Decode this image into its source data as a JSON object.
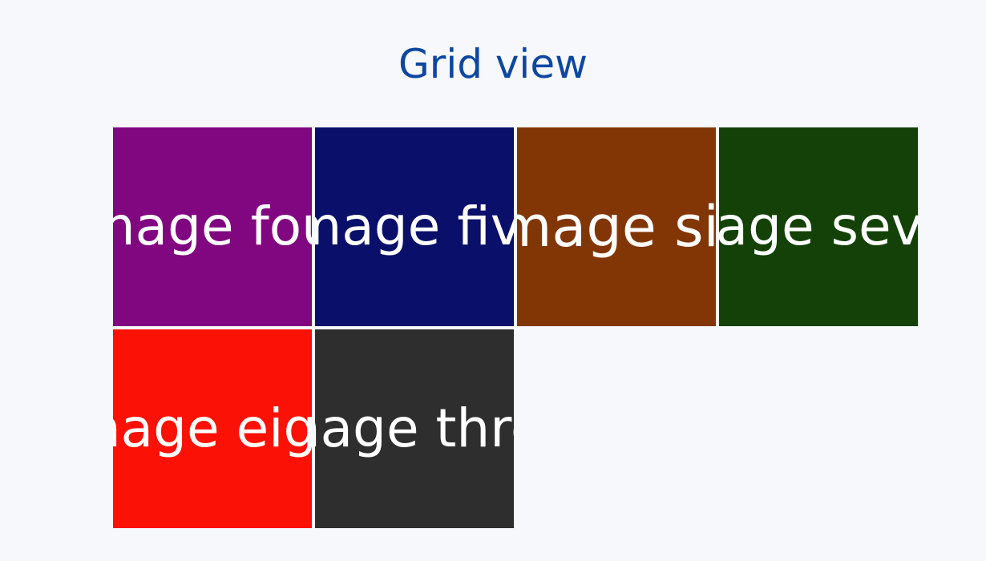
{
  "header": {
    "title": "Grid view"
  },
  "grid": {
    "tiles": [
      {
        "label": "Image four",
        "color": "#800780"
      },
      {
        "label": "Image five",
        "color": "#0a0f69"
      },
      {
        "label": "Image six",
        "color": "#823605"
      },
      {
        "label": "Image seven",
        "color": "#134107"
      },
      {
        "label": "Image eight",
        "color": "#fb1105"
      },
      {
        "label": "Image three",
        "color": "#2e2e2e"
      }
    ]
  },
  "colors": {
    "background": "#f6f8fc",
    "title": "#0d47a1",
    "tile_text": "#ffffff"
  }
}
